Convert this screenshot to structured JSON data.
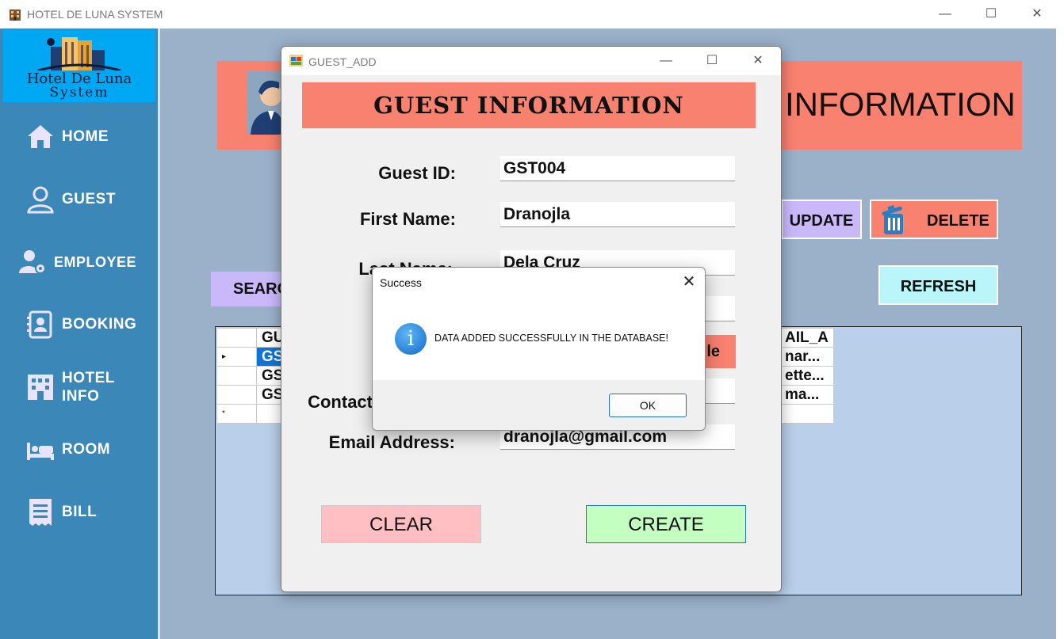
{
  "main_window": {
    "title": "HOTEL DE LUNA SYSTEM",
    "controls": {
      "minimize": "—",
      "maximize": "☐",
      "close": "✕"
    }
  },
  "sidebar": {
    "logo_line1": "Hotel De Luna",
    "logo_line2": "System",
    "items": [
      {
        "label": "HOME",
        "icon": "home-icon"
      },
      {
        "label": "GUEST",
        "icon": "user-icon"
      },
      {
        "label": "EMPLOYEE",
        "icon": "employee-icon"
      },
      {
        "label": "BOOKING",
        "icon": "contact-book-icon"
      },
      {
        "label": "HOTEL",
        "label2": "INFO",
        "icon": "building-icon"
      },
      {
        "label": "ROOM",
        "icon": "bed-icon"
      },
      {
        "label": "BILL",
        "icon": "receipt-icon"
      }
    ]
  },
  "banner": {
    "title": "INFORMATION"
  },
  "buttons": {
    "update": "UPDATE",
    "delete": "DELETE",
    "refresh": "REFRESH",
    "search": "SEARC"
  },
  "grid": {
    "header": [
      "GU",
      "AIL_A"
    ],
    "rows": [
      {
        "marker": "▸",
        "id": "GS",
        "email": "nar..."
      },
      {
        "marker": "",
        "id": "GS",
        "email": "ette..."
      },
      {
        "marker": "",
        "id": "GS",
        "email": "ma..."
      },
      {
        "marker": "*",
        "id": "",
        "email": ""
      }
    ]
  },
  "guest_dialog": {
    "title": "GUEST_ADD",
    "controls": {
      "minimize": "—",
      "maximize": "☐",
      "close": "✕"
    },
    "header": "GUEST INFORMATION",
    "fields": {
      "guest_id_label": "Guest ID:",
      "guest_id_value": "GST004",
      "first_name_label": "First Name:",
      "first_name_value": "Dranojla",
      "last_name_label": "Last Name:",
      "last_name_value": "Dela Cruz",
      "contact_label": "Contact",
      "email_label": "Email Address:",
      "email_value": "dranojla@gmail.com"
    },
    "gender_partial": "le",
    "clear": "CLEAR",
    "create": "CREATE"
  },
  "message_box": {
    "title": "Success",
    "close": "✕",
    "icon": "info-icon",
    "icon_glyph": "i",
    "message": "DATA ADDED SUCCESSFULLY IN THE DATABASE!",
    "ok": "OK"
  },
  "colors": {
    "sidebar": "#3a87b8",
    "logo_bg": "#00a8f3",
    "banner": "#f88170",
    "update": "#c9b9fb",
    "refresh": "#b9f5f9",
    "clear": "#ffbfc3",
    "create": "#c2ffc0",
    "selection": "#0f74d8"
  }
}
